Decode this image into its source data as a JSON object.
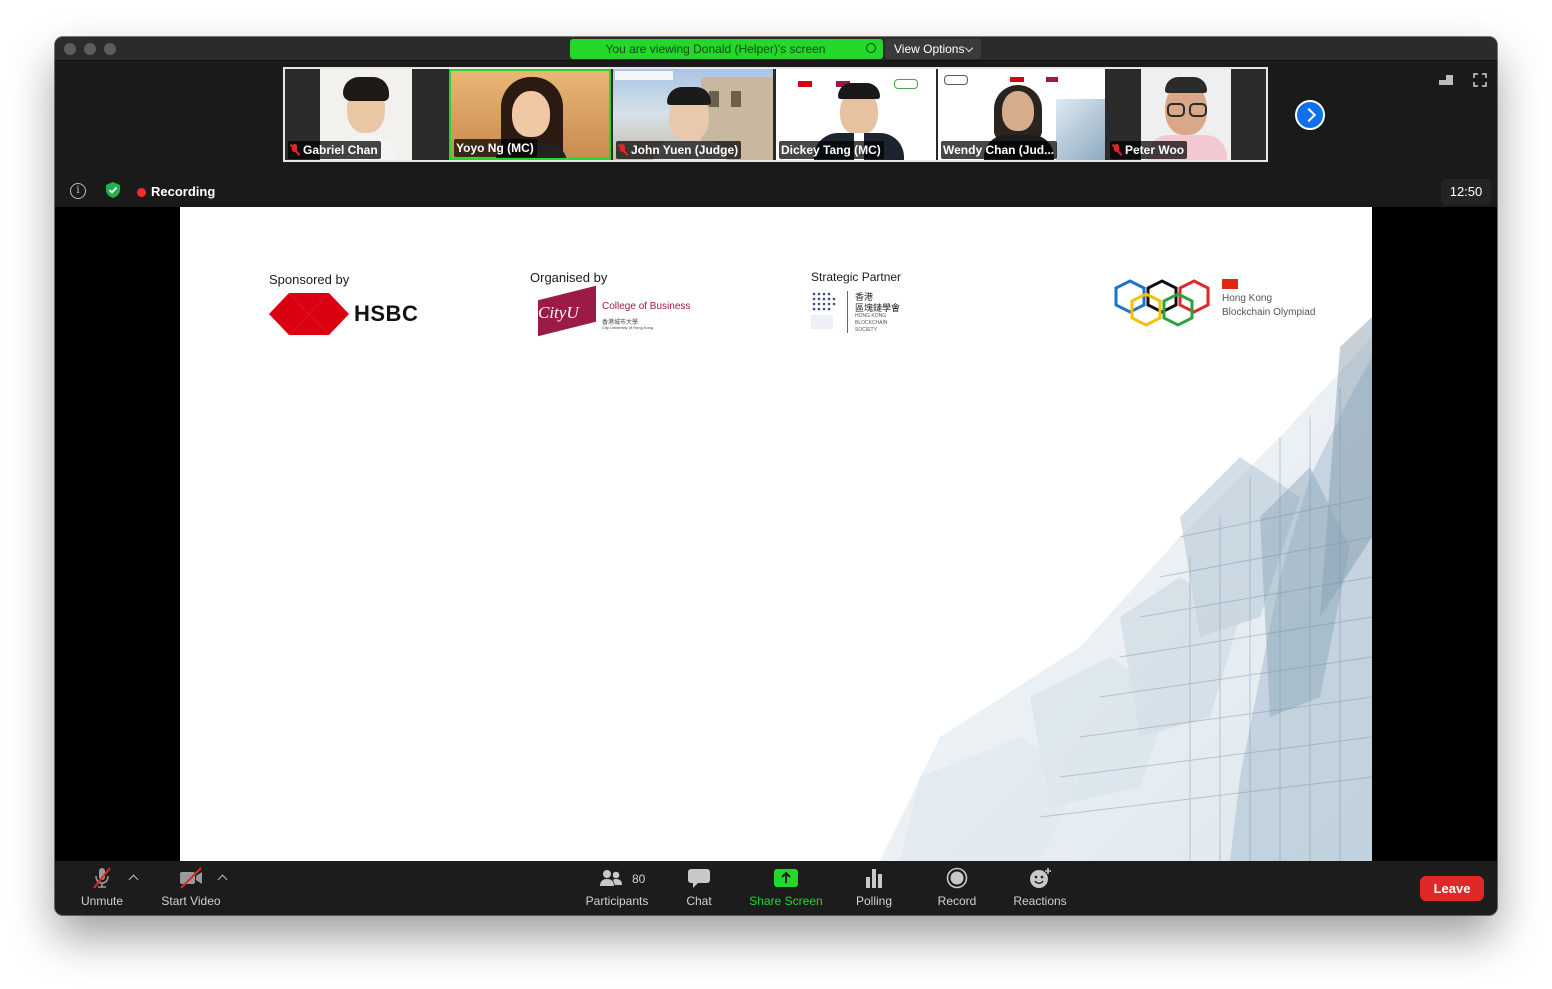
{
  "banner": {
    "text": "You are viewing Donald (Helper)'s screen"
  },
  "view_options": {
    "label": "View Options"
  },
  "participants_strip": [
    {
      "name": "Gabriel Chan",
      "muted": true
    },
    {
      "name": "Yoyo Ng (MC)",
      "muted": false
    },
    {
      "name": "John Yuen (Judge)",
      "muted": true
    },
    {
      "name": "Dickey Tang (MC)",
      "muted": false
    },
    {
      "name": "Wendy Chan (Jud...",
      "muted": false
    },
    {
      "name": "Peter Woo",
      "muted": true
    }
  ],
  "meeting": {
    "recording_label": "Recording",
    "clock": "12:50"
  },
  "slide": {
    "sponsored_by": "Sponsored by",
    "sponsor_name": "HSBC",
    "organised_by": "Organised by",
    "organiser_logo": "CityU",
    "organiser_unit": "College of Business",
    "organiser_chinese": "香港城市大學",
    "organiser_english_small": "City University of Hong Kong",
    "strategic_partner": "Strategic Partner",
    "partner_chinese_1": "香港",
    "partner_chinese_2": "區塊鏈學會",
    "partner_english_1": "HONG KONG",
    "partner_english_2": "BLOCKCHAIN",
    "partner_english_3": "SOCIETY",
    "olympiad_line1": "Hong Kong",
    "olympiad_line2": "Blockchain Olympiad"
  },
  "toolbar": {
    "unmute": "Unmute",
    "start_video": "Start Video",
    "participants": "Participants",
    "participants_count": "80",
    "chat": "Chat",
    "share_screen": "Share Screen",
    "polling": "Polling",
    "record": "Record",
    "reactions": "Reactions",
    "leave": "Leave"
  },
  "colors": {
    "banner_green": "#23d82a",
    "share_green": "#23d82a",
    "leave_red": "#e02828",
    "record_red": "#ff2a2a",
    "hsbc_red": "#db0011",
    "cityu_maroon": "#9b1b45",
    "next_blue": "#0e71eb"
  },
  "icons": [
    "mic-muted-icon",
    "video-off-icon",
    "participants-icon",
    "chat-icon",
    "share-screen-icon",
    "polling-icon",
    "record-icon",
    "reactions-icon",
    "info-icon",
    "shield-icon",
    "next-page-icon",
    "speaker-view-icon",
    "fullscreen-icon"
  ]
}
